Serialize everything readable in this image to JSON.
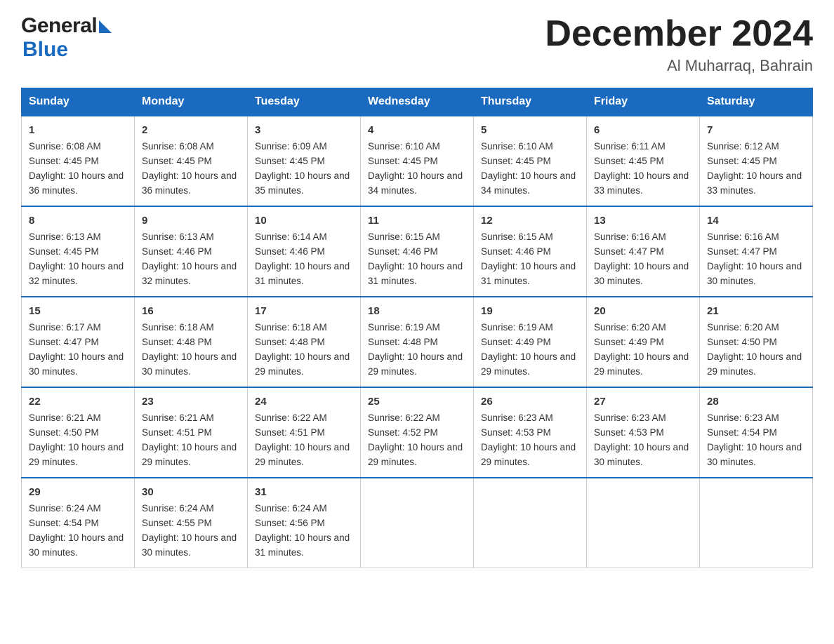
{
  "header": {
    "logo_general": "General",
    "logo_blue": "Blue",
    "title": "December 2024",
    "subtitle": "Al Muharraq, Bahrain"
  },
  "calendar": {
    "days_of_week": [
      "Sunday",
      "Monday",
      "Tuesday",
      "Wednesday",
      "Thursday",
      "Friday",
      "Saturday"
    ],
    "weeks": [
      [
        {
          "day": "1",
          "sunrise": "6:08 AM",
          "sunset": "4:45 PM",
          "daylight": "10 hours and 36 minutes."
        },
        {
          "day": "2",
          "sunrise": "6:08 AM",
          "sunset": "4:45 PM",
          "daylight": "10 hours and 36 minutes."
        },
        {
          "day": "3",
          "sunrise": "6:09 AM",
          "sunset": "4:45 PM",
          "daylight": "10 hours and 35 minutes."
        },
        {
          "day": "4",
          "sunrise": "6:10 AM",
          "sunset": "4:45 PM",
          "daylight": "10 hours and 34 minutes."
        },
        {
          "day": "5",
          "sunrise": "6:10 AM",
          "sunset": "4:45 PM",
          "daylight": "10 hours and 34 minutes."
        },
        {
          "day": "6",
          "sunrise": "6:11 AM",
          "sunset": "4:45 PM",
          "daylight": "10 hours and 33 minutes."
        },
        {
          "day": "7",
          "sunrise": "6:12 AM",
          "sunset": "4:45 PM",
          "daylight": "10 hours and 33 minutes."
        }
      ],
      [
        {
          "day": "8",
          "sunrise": "6:13 AM",
          "sunset": "4:45 PM",
          "daylight": "10 hours and 32 minutes."
        },
        {
          "day": "9",
          "sunrise": "6:13 AM",
          "sunset": "4:46 PM",
          "daylight": "10 hours and 32 minutes."
        },
        {
          "day": "10",
          "sunrise": "6:14 AM",
          "sunset": "4:46 PM",
          "daylight": "10 hours and 31 minutes."
        },
        {
          "day": "11",
          "sunrise": "6:15 AM",
          "sunset": "4:46 PM",
          "daylight": "10 hours and 31 minutes."
        },
        {
          "day": "12",
          "sunrise": "6:15 AM",
          "sunset": "4:46 PM",
          "daylight": "10 hours and 31 minutes."
        },
        {
          "day": "13",
          "sunrise": "6:16 AM",
          "sunset": "4:47 PM",
          "daylight": "10 hours and 30 minutes."
        },
        {
          "day": "14",
          "sunrise": "6:16 AM",
          "sunset": "4:47 PM",
          "daylight": "10 hours and 30 minutes."
        }
      ],
      [
        {
          "day": "15",
          "sunrise": "6:17 AM",
          "sunset": "4:47 PM",
          "daylight": "10 hours and 30 minutes."
        },
        {
          "day": "16",
          "sunrise": "6:18 AM",
          "sunset": "4:48 PM",
          "daylight": "10 hours and 30 minutes."
        },
        {
          "day": "17",
          "sunrise": "6:18 AM",
          "sunset": "4:48 PM",
          "daylight": "10 hours and 29 minutes."
        },
        {
          "day": "18",
          "sunrise": "6:19 AM",
          "sunset": "4:48 PM",
          "daylight": "10 hours and 29 minutes."
        },
        {
          "day": "19",
          "sunrise": "6:19 AM",
          "sunset": "4:49 PM",
          "daylight": "10 hours and 29 minutes."
        },
        {
          "day": "20",
          "sunrise": "6:20 AM",
          "sunset": "4:49 PM",
          "daylight": "10 hours and 29 minutes."
        },
        {
          "day": "21",
          "sunrise": "6:20 AM",
          "sunset": "4:50 PM",
          "daylight": "10 hours and 29 minutes."
        }
      ],
      [
        {
          "day": "22",
          "sunrise": "6:21 AM",
          "sunset": "4:50 PM",
          "daylight": "10 hours and 29 minutes."
        },
        {
          "day": "23",
          "sunrise": "6:21 AM",
          "sunset": "4:51 PM",
          "daylight": "10 hours and 29 minutes."
        },
        {
          "day": "24",
          "sunrise": "6:22 AM",
          "sunset": "4:51 PM",
          "daylight": "10 hours and 29 minutes."
        },
        {
          "day": "25",
          "sunrise": "6:22 AM",
          "sunset": "4:52 PM",
          "daylight": "10 hours and 29 minutes."
        },
        {
          "day": "26",
          "sunrise": "6:23 AM",
          "sunset": "4:53 PM",
          "daylight": "10 hours and 29 minutes."
        },
        {
          "day": "27",
          "sunrise": "6:23 AM",
          "sunset": "4:53 PM",
          "daylight": "10 hours and 30 minutes."
        },
        {
          "day": "28",
          "sunrise": "6:23 AM",
          "sunset": "4:54 PM",
          "daylight": "10 hours and 30 minutes."
        }
      ],
      [
        {
          "day": "29",
          "sunrise": "6:24 AM",
          "sunset": "4:54 PM",
          "daylight": "10 hours and 30 minutes."
        },
        {
          "day": "30",
          "sunrise": "6:24 AM",
          "sunset": "4:55 PM",
          "daylight": "10 hours and 30 minutes."
        },
        {
          "day": "31",
          "sunrise": "6:24 AM",
          "sunset": "4:56 PM",
          "daylight": "10 hours and 31 minutes."
        },
        null,
        null,
        null,
        null
      ]
    ],
    "labels": {
      "sunrise": "Sunrise:",
      "sunset": "Sunset:",
      "daylight": "Daylight:"
    }
  }
}
